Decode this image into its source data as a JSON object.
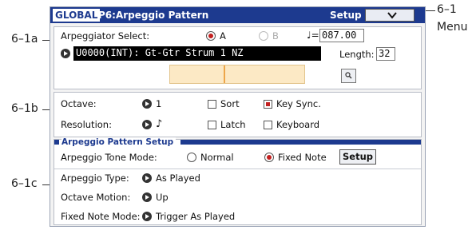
{
  "callouts": {
    "c1": "6–1",
    "menu": "Menu",
    "a": "6–1a",
    "b": "6–1b",
    "c": "6–1c"
  },
  "titlebar": {
    "mode": "GLOBAL",
    "page": "P6:Arpeggio Pattern",
    "tab": "Setup"
  },
  "arp_select": {
    "label": "Arpeggiator Select:",
    "option_a": "A",
    "option_b": "B",
    "tempo_symbol": "♩=",
    "tempo": "087.00",
    "pattern_name": "U0000(INT): Gt-Gtr Strum 1 NZ",
    "length_label": "Length:",
    "length": "32",
    "grid_cursor": 0.4
  },
  "octave_section": {
    "octave_label": "Octave:",
    "octave_value": "1",
    "resolution_label": "Resolution:",
    "resolution_value": "♪",
    "sort_label": "Sort",
    "sort_checked": false,
    "keysync_label": "Key Sync.",
    "keysync_checked": true,
    "latch_label": "Latch",
    "latch_checked": false,
    "keyboard_label": "Keyboard",
    "keyboard_checked": false
  },
  "pattern_setup": {
    "header": "Arpeggio Pattern Setup",
    "tone_mode_label": "Arpeggio Tone Mode:",
    "normal_label": "Normal",
    "fixed_note_label": "Fixed Note",
    "selected_mode": "Fixed Note",
    "setup_button": "Setup",
    "type_label": "Arpeggio Type:",
    "type_value": "As Played",
    "octave_motion_label": "Octave Motion:",
    "octave_motion_value": "Up",
    "fixed_mode_label": "Fixed Note Mode:",
    "fixed_mode_value": "Trigger As Played"
  }
}
